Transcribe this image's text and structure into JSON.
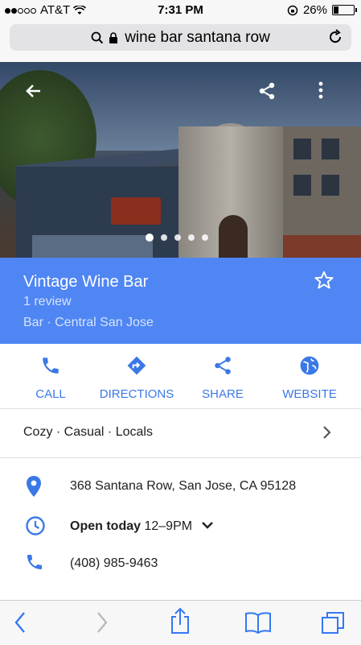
{
  "status_bar": {
    "carrier": "AT&T",
    "time": "7:31 PM",
    "battery": "26%",
    "battery_level": 0.26
  },
  "url_bar": {
    "query": "wine bar santana row"
  },
  "hero": {
    "photo_count": 5,
    "active_index": 0
  },
  "place": {
    "name": "Vintage Wine Bar",
    "reviews": "1 review",
    "category": "Bar · Central San Jose"
  },
  "actions": [
    {
      "label": "CALL",
      "icon": "phone-icon"
    },
    {
      "label": "DIRECTIONS",
      "icon": "directions-icon"
    },
    {
      "label": "SHARE",
      "icon": "share-icon"
    },
    {
      "label": "WEBSITE",
      "icon": "globe-icon"
    }
  ],
  "tags": "Cozy · Casual · Locals",
  "info": {
    "address": "368 Santana Row, San Jose, CA 95128",
    "hours_status": "Open today",
    "hours": "12–9PM",
    "phone": "(408) 985-9463"
  },
  "colors": {
    "accent": "#4f86f4",
    "action_blue": "#3b78e7",
    "ios_blue": "#3478f6"
  }
}
